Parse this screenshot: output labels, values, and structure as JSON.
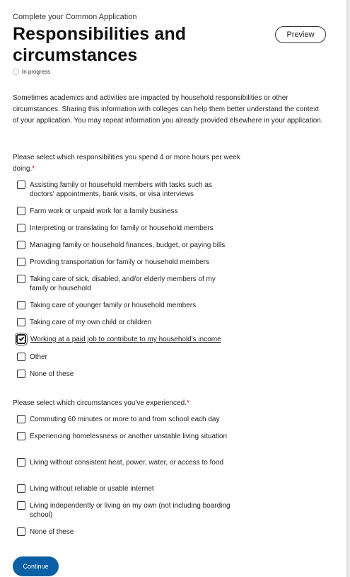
{
  "header": {
    "eyebrow": "Complete your Common Application",
    "title": "Responsibilities and circumstances",
    "preview_label": "Preview",
    "status": "In progress"
  },
  "intro": "Sometimes academics and activities are impacted by household responsibilities or other circumstances. Sharing this information with colleges can help them better understand the context of your application. You may repeat information you already provided elsewhere in your application.",
  "responsibilities": {
    "label": "Please select which responsibilities you spend 4 or more hours per week doing.",
    "required_mark": "*",
    "options": [
      {
        "label": "Assisting family or household members with tasks such as doctors' appointments, bank visits, or visa interviews",
        "checked": false
      },
      {
        "label": "Farm work or unpaid work for a family business",
        "checked": false
      },
      {
        "label": "Interpreting or translating for family or household members",
        "checked": false
      },
      {
        "label": "Managing family or household finances, budget, or paying bills",
        "checked": false
      },
      {
        "label": "Providing transportation for family or household members",
        "checked": false
      },
      {
        "label": "Taking care of sick, disabled, and/or elderly members of my family or household",
        "checked": false
      },
      {
        "label": "Taking care of younger family or household members",
        "checked": false
      },
      {
        "label": "Taking care of my own child or children",
        "checked": false
      },
      {
        "label": "Working at a paid job to contribute to my household's income",
        "checked": true
      },
      {
        "label": "Other",
        "checked": false
      },
      {
        "label": "None of these",
        "checked": false
      }
    ]
  },
  "circumstances": {
    "label": "Please select which circumstances you've experienced.",
    "required_mark": "*",
    "options": [
      {
        "label": "Commuting 60 minutes or more to and from school each day",
        "checked": false
      },
      {
        "label": "Experiencing homelessness or another unstable living situation",
        "checked": false
      },
      {
        "label": "Living without consistent heat, power, water, or access to food",
        "checked": false
      },
      {
        "label": "Living without reliable or usable internet",
        "checked": false
      },
      {
        "label": "Living independently or living on my own (not including boarding school)",
        "checked": false
      },
      {
        "label": "None of these",
        "checked": false
      }
    ]
  },
  "footer": {
    "continue_label": "Continue"
  },
  "colors": {
    "primary": "#0b5fa5",
    "required": "#d0021b",
    "status_icon": "#4a7fc0"
  }
}
